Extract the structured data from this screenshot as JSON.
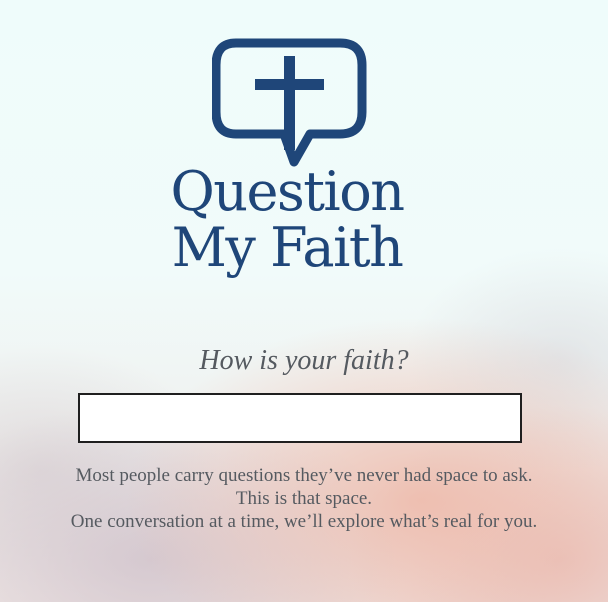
{
  "brand": {
    "line1": "Question",
    "line2": "My Faith",
    "icon": "cross-speech-bubble-icon",
    "color": "#1f4679"
  },
  "prompt": {
    "question": "How is your faith?"
  },
  "answer_input": {
    "value": "",
    "placeholder": ""
  },
  "intro": {
    "line1": "Most people carry questions they’ve never had space to ask.",
    "line2": "This is that space.",
    "line3": "One conversation at a time, we’ll explore what’s real for you."
  }
}
